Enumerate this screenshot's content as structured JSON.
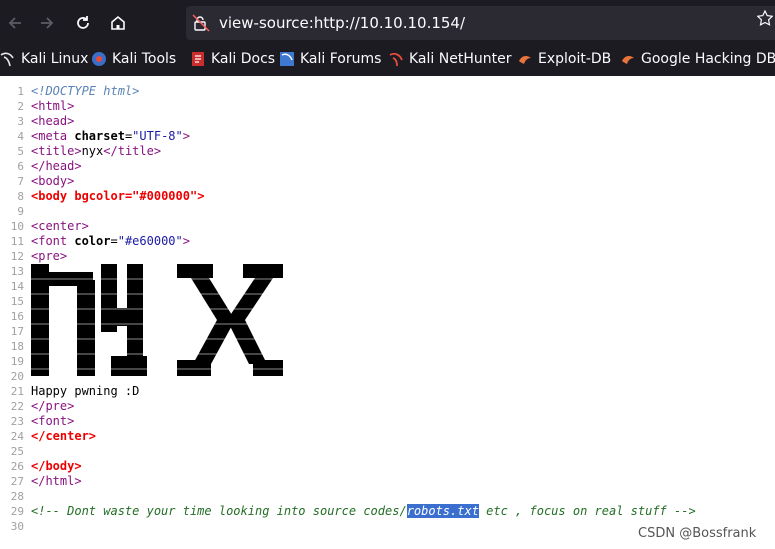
{
  "browser": {
    "url": "view-source:http://10.10.10.154/",
    "bookmarks": [
      "Kali Linux",
      "Kali Tools",
      "Kali Docs",
      "Kali Forums",
      "Kali NetHunter",
      "Exploit-DB",
      "Google Hacking DB"
    ]
  },
  "source": {
    "line_numbers": [
      "1",
      "2",
      "3",
      "4",
      "5",
      "6",
      "7",
      "8",
      "9",
      "10",
      "11",
      "12",
      "13",
      "14",
      "15",
      "16",
      "17",
      "18",
      "19",
      "20",
      "21",
      "22",
      "23",
      "24",
      "25",
      "26",
      "27",
      "28",
      "29",
      "30"
    ],
    "l1": "<!DOCTYPE html>",
    "l2": "<html>",
    "l3": "<head>",
    "l4_tag_open": "<meta ",
    "l4_attr": "charset",
    "l4_eq": "=",
    "l4_val": "\"UTF-8\"",
    "l4_close": ">",
    "l5_open": "<title>",
    "l5_text": "nyx",
    "l5_close": "</title>",
    "l6": "</head>",
    "l7": "<body>",
    "l8_open": "<body ",
    "l8_attr": "bgcolor",
    "l8_eq": "=",
    "l8_val": "\"#000000\"",
    "l8_close": ">",
    "l10": "<center>",
    "l11_open": "<font ",
    "l11_attr": "color",
    "l11_eq": "=",
    "l11_val": "\"#e60000\"",
    "l11_close": ">",
    "l12": "<pre>",
    "ascii_art_word": "nyx",
    "l21": "Happy pwning :D",
    "l22": "</pre>",
    "l23": "<font>",
    "l24": "</center>",
    "l26": "</body>",
    "l27": "</html>",
    "l29_pre": "<!-- Dont waste your time looking into source codes/",
    "l29_sel": "robots.txt",
    "l29_post": " etc , focus on real stuff -->"
  },
  "watermark": "CSDN @Bossfrank"
}
